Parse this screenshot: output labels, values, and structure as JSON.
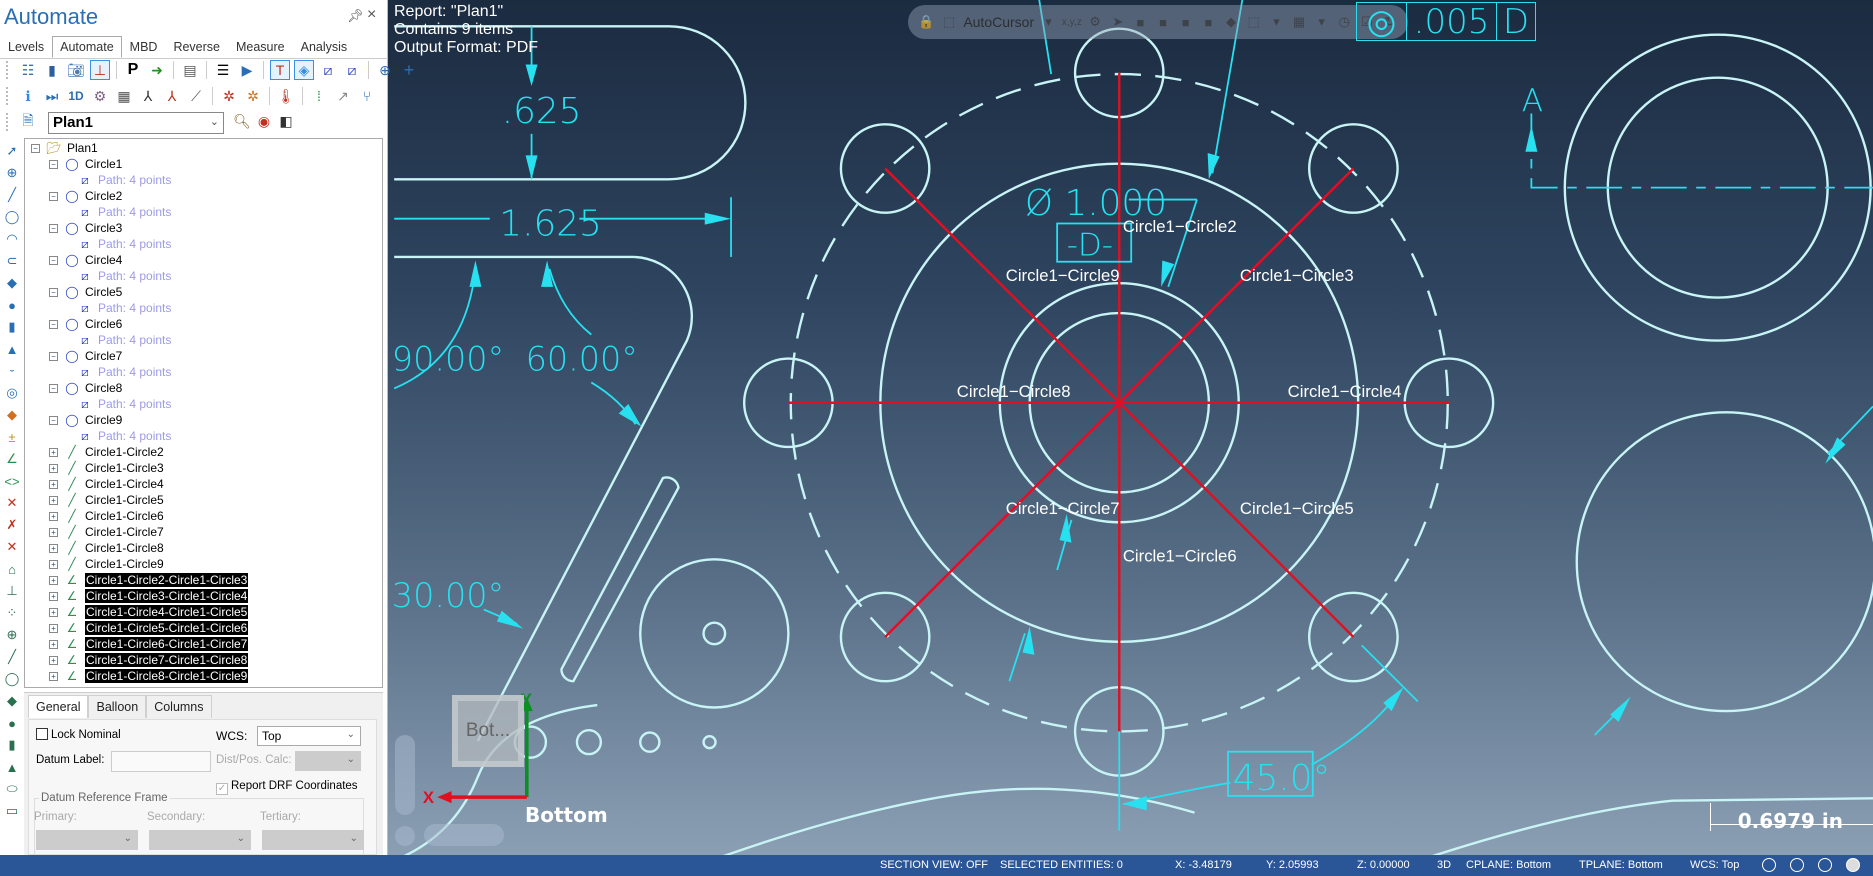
{
  "panel": {
    "title": "Automate",
    "pin_icon": "pin-icon",
    "close_label": "×",
    "ribbon_tabs": [
      "Levels",
      "Automate",
      "MBD",
      "Reverse",
      "Measure",
      "Analysis"
    ],
    "active_tab": "Automate",
    "plan_select": {
      "value": "Plan1"
    },
    "tree": {
      "root": "Plan1",
      "circles": [
        {
          "label": "Circle1",
          "child": "Path: 4 points"
        },
        {
          "label": "Circle2",
          "child": "Path: 4 points"
        },
        {
          "label": "Circle3",
          "child": "Path: 4 points"
        },
        {
          "label": "Circle4",
          "child": "Path: 4 points"
        },
        {
          "label": "Circle5",
          "child": "Path: 4 points"
        },
        {
          "label": "Circle6",
          "child": "Path: 4 points"
        },
        {
          "label": "Circle7",
          "child": "Path: 4 points"
        },
        {
          "label": "Circle8",
          "child": "Path: 4 points"
        },
        {
          "label": "Circle9",
          "child": "Path: 4 points"
        }
      ],
      "distances": [
        "Circle1-Circle2",
        "Circle1-Circle3",
        "Circle1-Circle4",
        "Circle1-Circle5",
        "Circle1-Circle6",
        "Circle1-Circle7",
        "Circle1-Circle8",
        "Circle1-Circle9"
      ],
      "angles_selected": [
        "Circle1-Circle2-Circle1-Circle3",
        "Circle1-Circle3-Circle1-Circle4",
        "Circle1-Circle4-Circle1-Circle5",
        "Circle1-Circle5-Circle1-Circle6",
        "Circle1-Circle6-Circle1-Circle7",
        "Circle1-Circle7-Circle1-Circle8",
        "Circle1-Circle8-Circle1-Circle9"
      ]
    },
    "props": {
      "tabs": [
        "General",
        "Balloon",
        "Columns"
      ],
      "active_tab": "General",
      "lock_nominal_label": "Lock Nominal",
      "lock_nominal_checked": false,
      "wcs_label": "WCS:",
      "wcs_value": "Top",
      "datum_label_label": "Datum Label:",
      "datum_label_value": "",
      "dist_pos_calc_label": "Dist/Pos. Calc:",
      "report_drf_label": "Report DRF Coordinates",
      "report_drf_checked": true,
      "drf_group_label": "Datum Reference Frame",
      "primary_label": "Primary:",
      "secondary_label": "Secondary:",
      "tertiary_label": "Tertiary:"
    }
  },
  "viewport": {
    "report_lines": [
      "Report: \"Plan1\"",
      "Contains 9 items",
      "Output Format: PDF"
    ],
    "float_toolbar": {
      "autocursor_label": "AutoCursor",
      "xyz_label": "x,y,z"
    },
    "fcf": {
      "symbol": "◎",
      "tolerance": ".005",
      "datum": "D"
    },
    "dimensions": {
      "slot_width": ".625",
      "slot_length": "1.625",
      "angle_90": "90.00°",
      "angle_60": "60.00°",
      "angle_30": "30.00°",
      "diameter": "Ø 1.000",
      "datum_d": "-D-",
      "angle_45": "45.0°",
      "section_a": "A"
    },
    "circle_labels": [
      "Circle1−Circle2",
      "Circle1−Circle3",
      "Circle1−Circle4",
      "Circle1−Circle5",
      "Circle1−Circle6",
      "Circle1−Circle7",
      "Circle1−Circle8",
      "Circle1−Circle9"
    ],
    "view_cube_label": "Bot...",
    "view_label": "Bottom",
    "axis_x": "X",
    "axis_y": "Y",
    "scale_label": "0.6979 in"
  },
  "statusbar": {
    "section_view": "SECTION VIEW: OFF",
    "selected": "SELECTED ENTITIES: 0",
    "x": "X:  -3.48179",
    "y": "Y:  2.05993",
    "z": "Z:  0.00000",
    "mode": "3D",
    "cplane": "CPLANE: Bottom",
    "tplane": "TPLANE: Bottom",
    "wcs": "WCS: Top"
  },
  "colors": {
    "dimension": "#27e0f0",
    "geometry": "#c8f4f6",
    "red_line": "#e01020",
    "status_bar": "#2a5697",
    "panel_title": "#2a6fb5"
  }
}
